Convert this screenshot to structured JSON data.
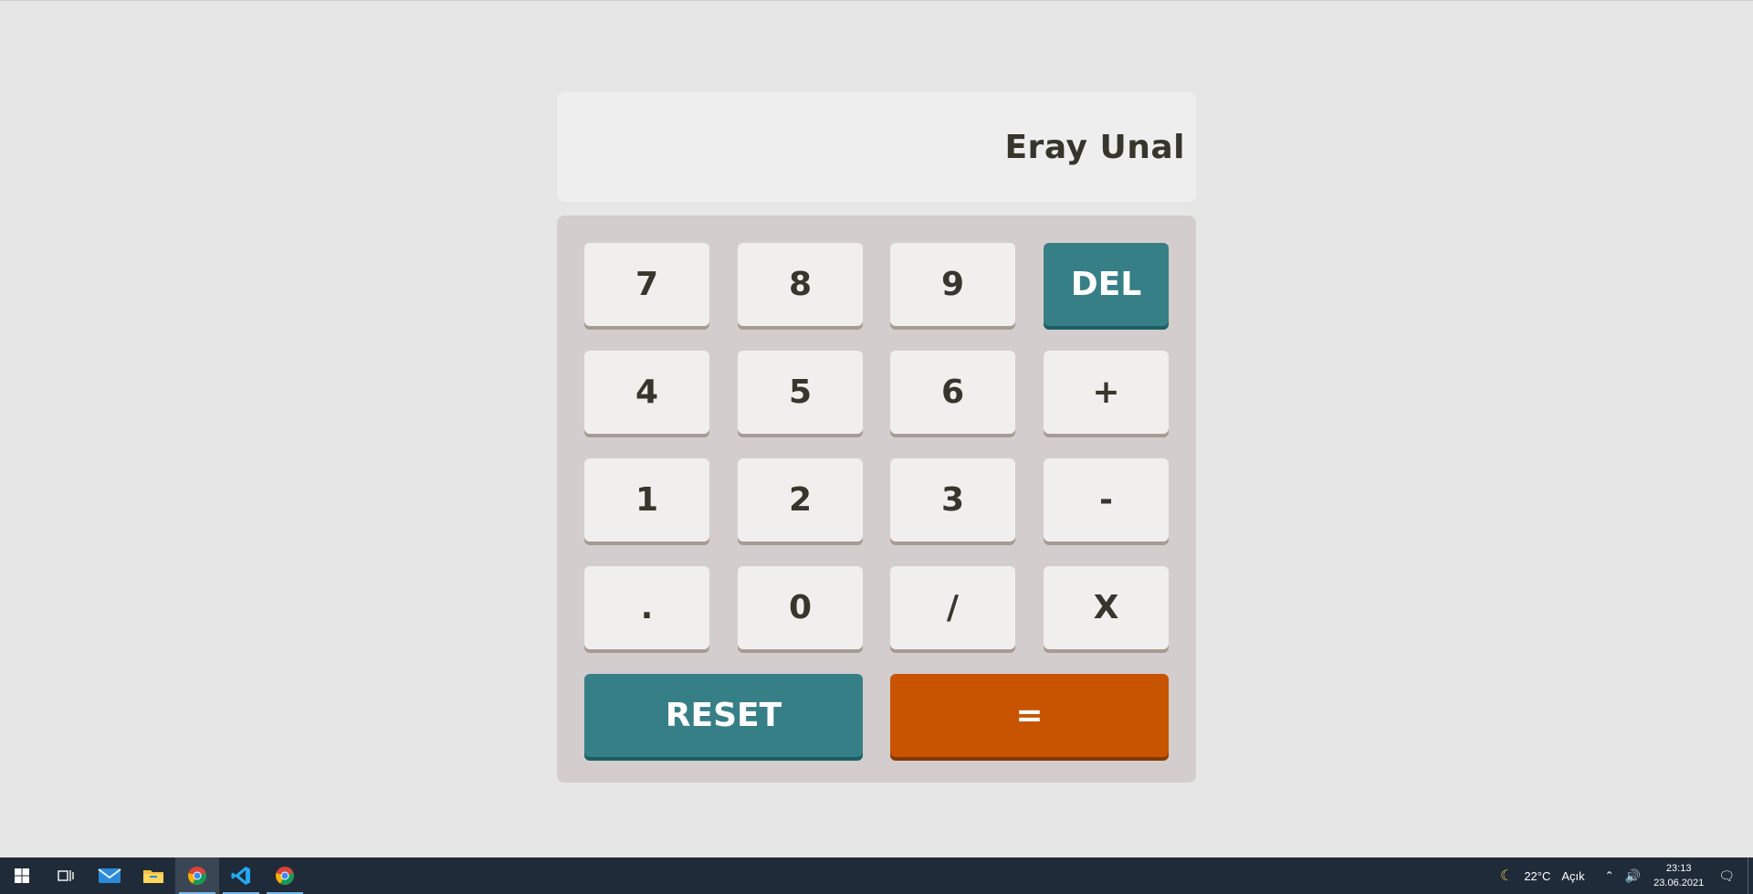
{
  "display": {
    "value": "Eray Unal"
  },
  "keys": {
    "row1": [
      "7",
      "8",
      "9",
      "DEL"
    ],
    "row2": [
      "4",
      "5",
      "6",
      "+"
    ],
    "row3": [
      "1",
      "2",
      "3",
      "-"
    ],
    "row4": [
      ".",
      "0",
      "/",
      "X"
    ],
    "reset": "RESET",
    "equals": "="
  },
  "colors": {
    "background": "#e6e6e6",
    "screen": "#eeeeee",
    "keypad": "#d3cdcd",
    "key": "#f0efee",
    "key_text": "#36362c",
    "teal": "#377f86",
    "orange": "#c85402"
  },
  "taskbar": {
    "icons": [
      "windows-start-icon",
      "task-view-icon",
      "mail-icon",
      "file-explorer-icon",
      "chrome-icon",
      "vscode-icon",
      "chrome-icon"
    ],
    "weather": "22°C",
    "weather_desc": "Açık",
    "time": "23:13",
    "date": "23.06.2021"
  }
}
